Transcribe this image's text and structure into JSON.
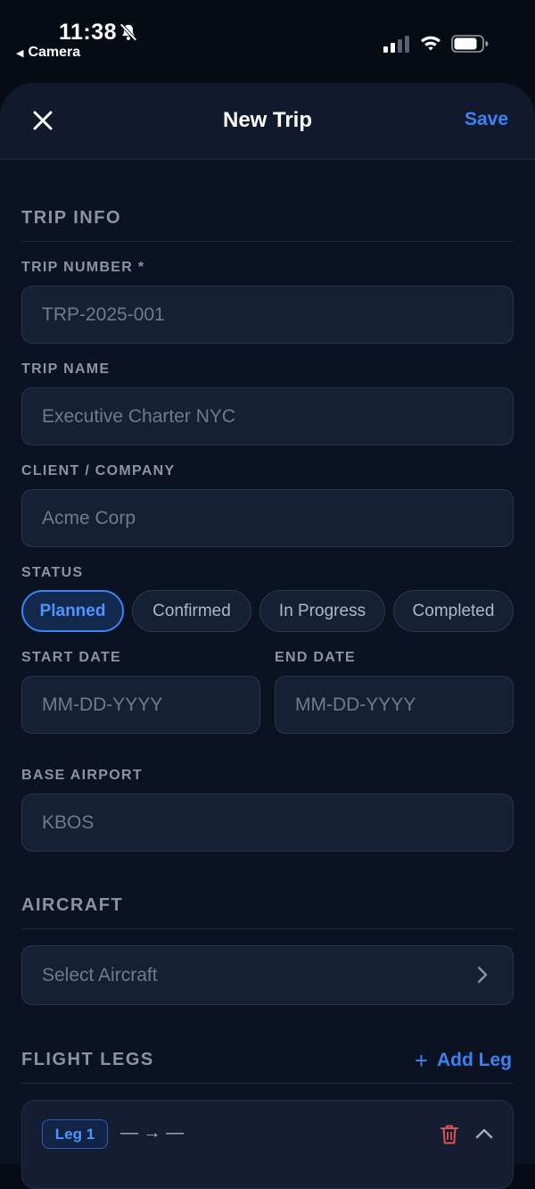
{
  "status_bar": {
    "time": "11:38",
    "back_app": "Camera"
  },
  "nav": {
    "title": "New Trip",
    "save_label": "Save"
  },
  "trip_info": {
    "header": "TRIP INFO",
    "trip_number": {
      "label": "TRIP NUMBER *",
      "placeholder": "TRP-2025-001"
    },
    "trip_name": {
      "label": "TRIP NAME",
      "placeholder": "Executive Charter NYC"
    },
    "client": {
      "label": "CLIENT / COMPANY",
      "placeholder": "Acme Corp"
    },
    "status": {
      "label": "STATUS",
      "options": [
        "Planned",
        "Confirmed",
        "In Progress",
        "Completed"
      ],
      "selected": "Planned"
    },
    "start_date": {
      "label": "START DATE",
      "placeholder": "MM-DD-YYYY"
    },
    "end_date": {
      "label": "END DATE",
      "placeholder": "MM-DD-YYYY"
    },
    "base_airport": {
      "label": "BASE AIRPORT",
      "placeholder": "KBOS"
    }
  },
  "aircraft": {
    "header": "AIRCRAFT",
    "select_placeholder": "Select Aircraft"
  },
  "flight_legs": {
    "header": "FLIGHT LEGS",
    "add_label": "Add Leg",
    "legs": [
      {
        "badge": "Leg 1",
        "route": "— → —"
      }
    ]
  },
  "colors": {
    "accent": "#3b82f6",
    "background": "#0b1221",
    "field": "#162035",
    "danger": "#e05252"
  }
}
